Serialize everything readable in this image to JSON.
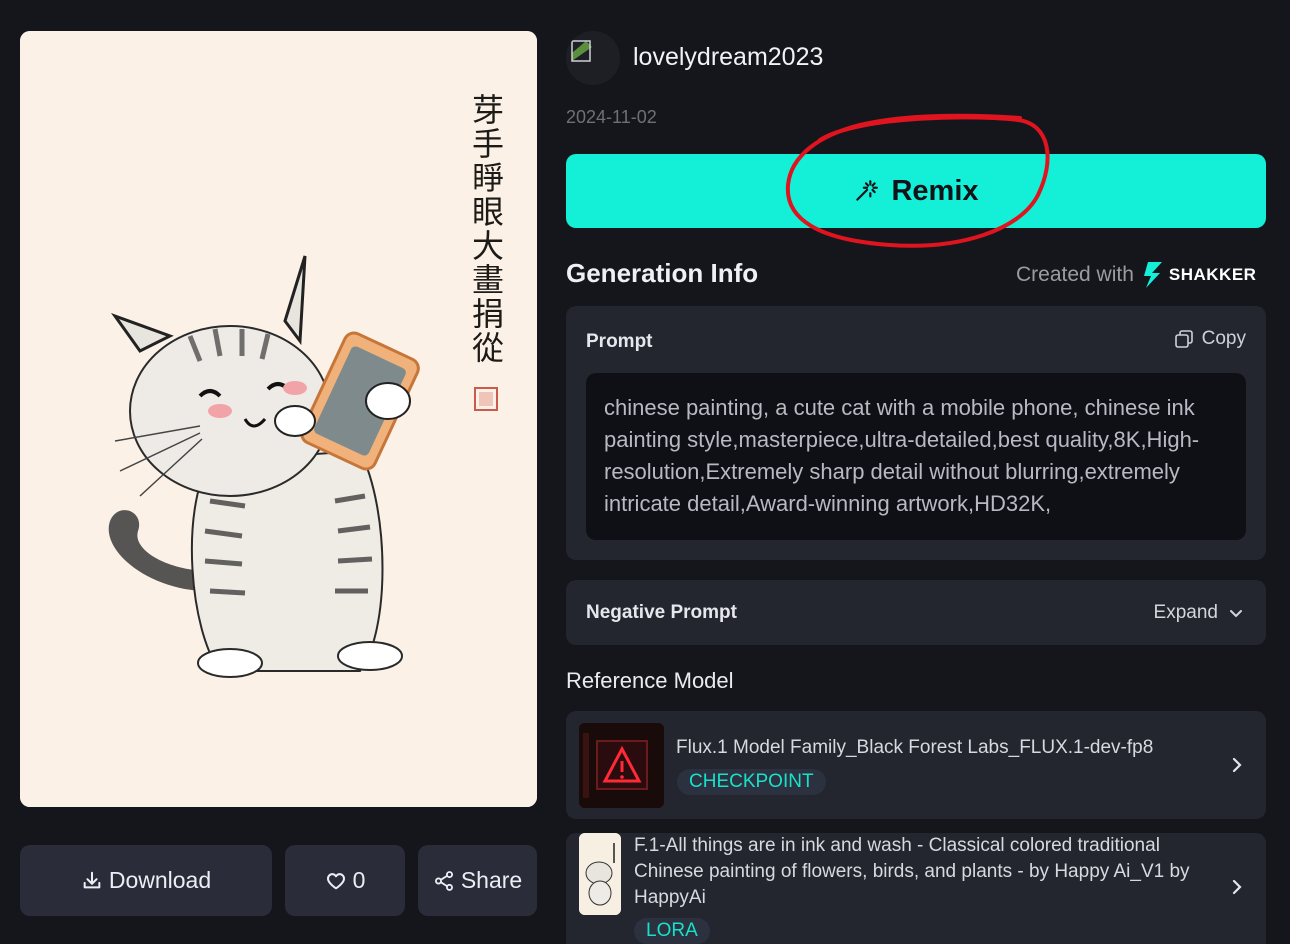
{
  "artwork": {
    "calligraphy": "芽手睜眼大畫捐從"
  },
  "actions": {
    "download_label": "Download",
    "like_count": "0",
    "share_label": "Share"
  },
  "author": {
    "username": "lovelydream2023",
    "date": "2024-11-02"
  },
  "remix": {
    "label": "Remix"
  },
  "generation_info": {
    "title": "Generation Info",
    "created_with_label": "Created with",
    "brand_name": "SHAKKER"
  },
  "prompt": {
    "label": "Prompt",
    "copy_label": "Copy",
    "text": "chinese painting, a cute cat with a mobile phone, chinese ink painting style,masterpiece,ultra-detailed,best quality,8K,High-resolution,Extremely sharp detail without blurring,extremely intricate detail,Award-winning artwork,HD32K,"
  },
  "negative_prompt": {
    "label": "Negative Prompt",
    "expand_label": "Expand"
  },
  "reference_model": {
    "title": "Reference Model",
    "models": [
      {
        "name": "Flux.1 Model Family_Black Forest Labs_FLUX.1-dev-fp8",
        "tag": "CHECKPOINT"
      },
      {
        "name": "F.1-All things are in ink and wash - Classical colored traditional Chinese painting of flowers, birds, and plants - by Happy Ai_V1 by HappyAi",
        "tag": "LORA"
      }
    ]
  },
  "colors": {
    "accent": "#14f0d8",
    "background": "#15161b",
    "panel": "#23252f",
    "annotation": "#e0141e"
  }
}
